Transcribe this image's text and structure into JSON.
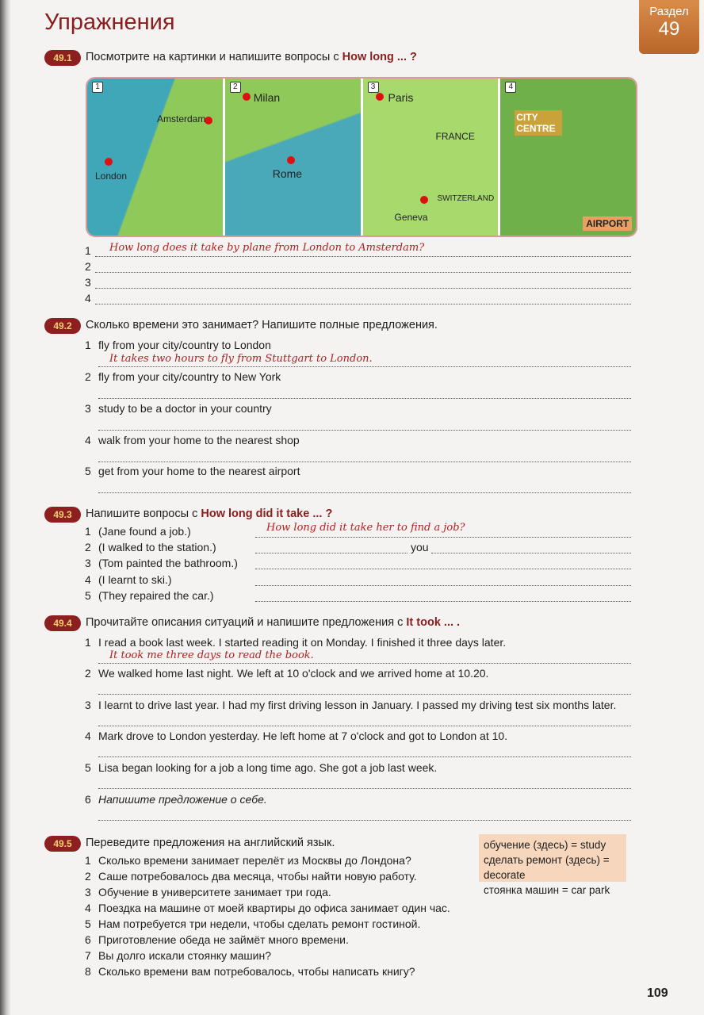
{
  "page_title": "Упражнения",
  "section_tab": {
    "label": "Раздел",
    "number": "49"
  },
  "ex1": {
    "id": "49.1",
    "instruction": "Посмотрите на картинки и напишите вопросы с ",
    "key": "How long ... ?",
    "map_panels": [
      {
        "n": "1",
        "labels": [
          "Amsterdam",
          "London"
        ]
      },
      {
        "n": "2",
        "labels": [
          "Milan",
          "Rome"
        ]
      },
      {
        "n": "3",
        "labels": [
          "Paris",
          "FRANCE",
          "SWITZERLAND",
          "Geneva"
        ]
      },
      {
        "n": "4",
        "labels": [
          "CITY CENTRE",
          "AIRPORT"
        ]
      }
    ],
    "items": [
      {
        "n": "1",
        "answer": "How long does it take by plane from London to Amsterdam?"
      },
      {
        "n": "2"
      },
      {
        "n": "3"
      },
      {
        "n": "4"
      }
    ]
  },
  "ex2": {
    "id": "49.2",
    "instruction": "Сколько времени это занимает?  Напишите полные предложения.",
    "items": [
      {
        "n": "1",
        "text": "fly from your city/country to London",
        "answer": "It takes two hours to fly from Stuttgart to London."
      },
      {
        "n": "2",
        "text": "fly from your city/country to New York"
      },
      {
        "n": "3",
        "text": "study to be a doctor in your country"
      },
      {
        "n": "4",
        "text": "walk from your home to the nearest shop"
      },
      {
        "n": "5",
        "text": "get from your home to the nearest airport"
      }
    ]
  },
  "ex3": {
    "id": "49.3",
    "instruction": "Напишите вопросы с ",
    "key": "How long did it take ... ?",
    "items": [
      {
        "n": "1",
        "text": "(Jane found a job.)",
        "answer": "How long did it take her to find a job?"
      },
      {
        "n": "2",
        "text": "(I walked to the station.)",
        "extra": "you"
      },
      {
        "n": "3",
        "text": "(Tom painted the bathroom.)"
      },
      {
        "n": "4",
        "text": "(I learnt to ski.)"
      },
      {
        "n": "5",
        "text": "(They repaired the car.)"
      }
    ]
  },
  "ex4": {
    "id": "49.4",
    "instruction": "Прочитайте описания ситуаций и напишите предложения с ",
    "key": "It took ... .",
    "items": [
      {
        "n": "1",
        "text": "I read a book last week.  I started reading it on Monday.  I finished it three days later.",
        "answer": "It took me three days to read the book."
      },
      {
        "n": "2",
        "text": "We walked home last night.  We left at 10 o'clock and we arrived home at 10.20."
      },
      {
        "n": "3",
        "text": "I learnt to drive last year.  I had my first driving lesson in January.  I passed my driving test six months later."
      },
      {
        "n": "4",
        "text": "Mark drove to London yesterday.  He left home at 7 o'clock and got to London at 10."
      },
      {
        "n": "5",
        "text": "Lisa began looking for a job a long time ago.  She got a job last week."
      },
      {
        "n": "6",
        "text": "Напишите предложение о себе."
      }
    ]
  },
  "ex5": {
    "id": "49.5",
    "instruction": "Переведите предложения на английский язык.",
    "glossary": [
      "обучение (здесь) = study",
      "сделать ремонт (здесь) = decorate",
      "стоянка машин = car park"
    ],
    "items": [
      {
        "n": "1",
        "text": "Сколько времени занимает перелёт из Москвы до Лондона?"
      },
      {
        "n": "2",
        "text": "Саше потребовалось два месяца, чтобы найти новую работу."
      },
      {
        "n": "3",
        "text": "Обучение в университете занимает три года."
      },
      {
        "n": "4",
        "text": "Поездка на машине от моей квартиры до офиса занимает один час."
      },
      {
        "n": "5",
        "text": "Нам потребуется три недели, чтобы сделать ремонт гостиной."
      },
      {
        "n": "6",
        "text": "Приготовление обеда не займёт много времени."
      },
      {
        "n": "7",
        "text": "Вы долго искали стоянку машин?"
      },
      {
        "n": "8",
        "text": "Сколько времени вам потребовалось, чтобы написать книгу?"
      }
    ]
  },
  "page_number": "109"
}
